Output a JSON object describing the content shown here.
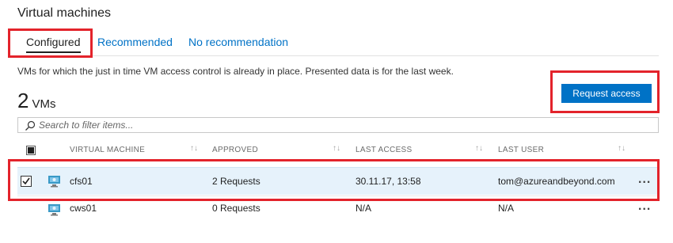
{
  "page": {
    "title": "Virtual machines"
  },
  "tabs": [
    {
      "label": "Configured"
    },
    {
      "label": "Recommended"
    },
    {
      "label": "No recommendation"
    }
  ],
  "description": "VMs for which the just in time VM access control is already in place. Presented data is for the last week.",
  "summary": {
    "count": "2",
    "unit": "VMs"
  },
  "request_button": {
    "label": "Request access"
  },
  "search": {
    "placeholder": "Search to filter items..."
  },
  "table": {
    "columns": [
      "VIRTUAL MACHINE",
      "APPROVED",
      "LAST ACCESS",
      "LAST USER"
    ],
    "rows": [
      {
        "name": "cfs01",
        "approved": "2 Requests",
        "last_access": "30.11.17, 13:58",
        "last_user": "tom@azureandbeyond.com",
        "selected": true
      },
      {
        "name": "cws01",
        "approved": "0 Requests",
        "last_access": "N/A",
        "last_user": "N/A",
        "selected": false
      }
    ],
    "row_menu": "..."
  },
  "colors": {
    "accent": "#0072c6",
    "highlight": "#e3232b",
    "selected_row": "#e6f2fb"
  }
}
